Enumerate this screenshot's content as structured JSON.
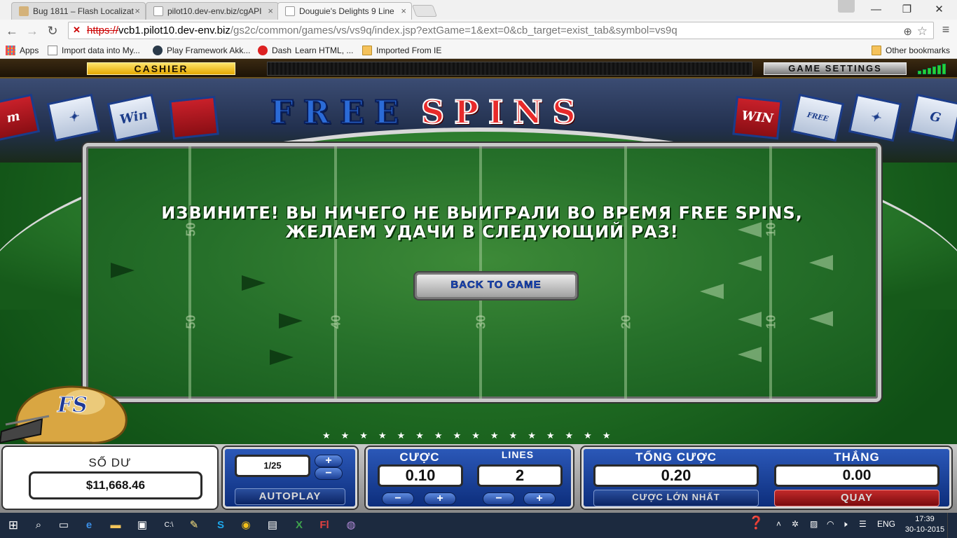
{
  "browser": {
    "tabs": [
      {
        "title": "Bug 1811 – Flash Localizat",
        "active": false
      },
      {
        "title": "pilot10.dev-env.biz/cgAPI",
        "active": false
      },
      {
        "title": "Douguie's Delights 9 Line",
        "active": true
      }
    ],
    "url": {
      "scheme": "https://",
      "host": "vcb1.pilot10.dev-env.biz",
      "path": "/gs2c/common/games/vs/vs9q/index.jsp?extGame=1&ext=0&cb_target=exist_tab&symbol=vs9q"
    },
    "bookmarks": [
      {
        "label": "Apps",
        "icon": "apps-grid-icon"
      },
      {
        "label": "Import data into My...",
        "icon": "page-icon"
      },
      {
        "label": "Play Framework Akk...",
        "icon": "play-framework-icon"
      },
      {
        "label": "Dash",
        "icon": "dash-icon"
      },
      {
        "label": "Learn HTML, ...",
        "icon": "none"
      },
      {
        "label": "Imported From IE",
        "icon": "folder-icon"
      }
    ],
    "other_bookmarks": "Other bookmarks"
  },
  "game": {
    "cashier_label": "CASHIER",
    "settings_label": "GAME SETTINGS",
    "title_word1": "FREE",
    "title_word2": "SPINS",
    "banners": {
      "left": [
        "m",
        "Win"
      ],
      "right": [
        "WIN",
        "FREE SPINS",
        "G"
      ]
    },
    "popup": {
      "message_line1": "ИЗВИНИТЕ! ВЫ НИЧЕГО НЕ ВЫИГРАЛИ ВО ВРЕМЯ FREE SPINS,",
      "message_line2": "ЖЕЛАЕМ УДАЧИ В СЛЕДУЮЩИЙ РАЗ!",
      "back_button": "BACK TO GAME",
      "yard_numbers": [
        "50",
        "50",
        "40",
        "30",
        "20",
        "10",
        "10"
      ]
    },
    "helmet_logo": "FS",
    "stars": "★★★★★★★★★★★★★★★★"
  },
  "controls": {
    "balance_label": "SỐ DƯ",
    "balance_value": "$11,668.46",
    "autoplay_count": "1/25",
    "autoplay_label": "AUTOPLAY",
    "bet_label": "CƯỢC",
    "bet_value": "0.10",
    "lines_label": "LINES",
    "lines_value": "2",
    "total_bet_label": "TỔNG CƯỢC",
    "total_bet_value": "0.20",
    "win_label": "THẮNG",
    "win_value": "0.00",
    "max_bet_label": "CƯỢC LỚN NHẤT",
    "spin_label": "QUAY",
    "plus": "+",
    "minus": "−",
    "colors": {
      "spin_button": "#a4161a",
      "panel_blue": "#0d2e7c"
    }
  },
  "taskbar": {
    "language": "ENG",
    "time": "17:39",
    "date": "30-10-2015"
  }
}
